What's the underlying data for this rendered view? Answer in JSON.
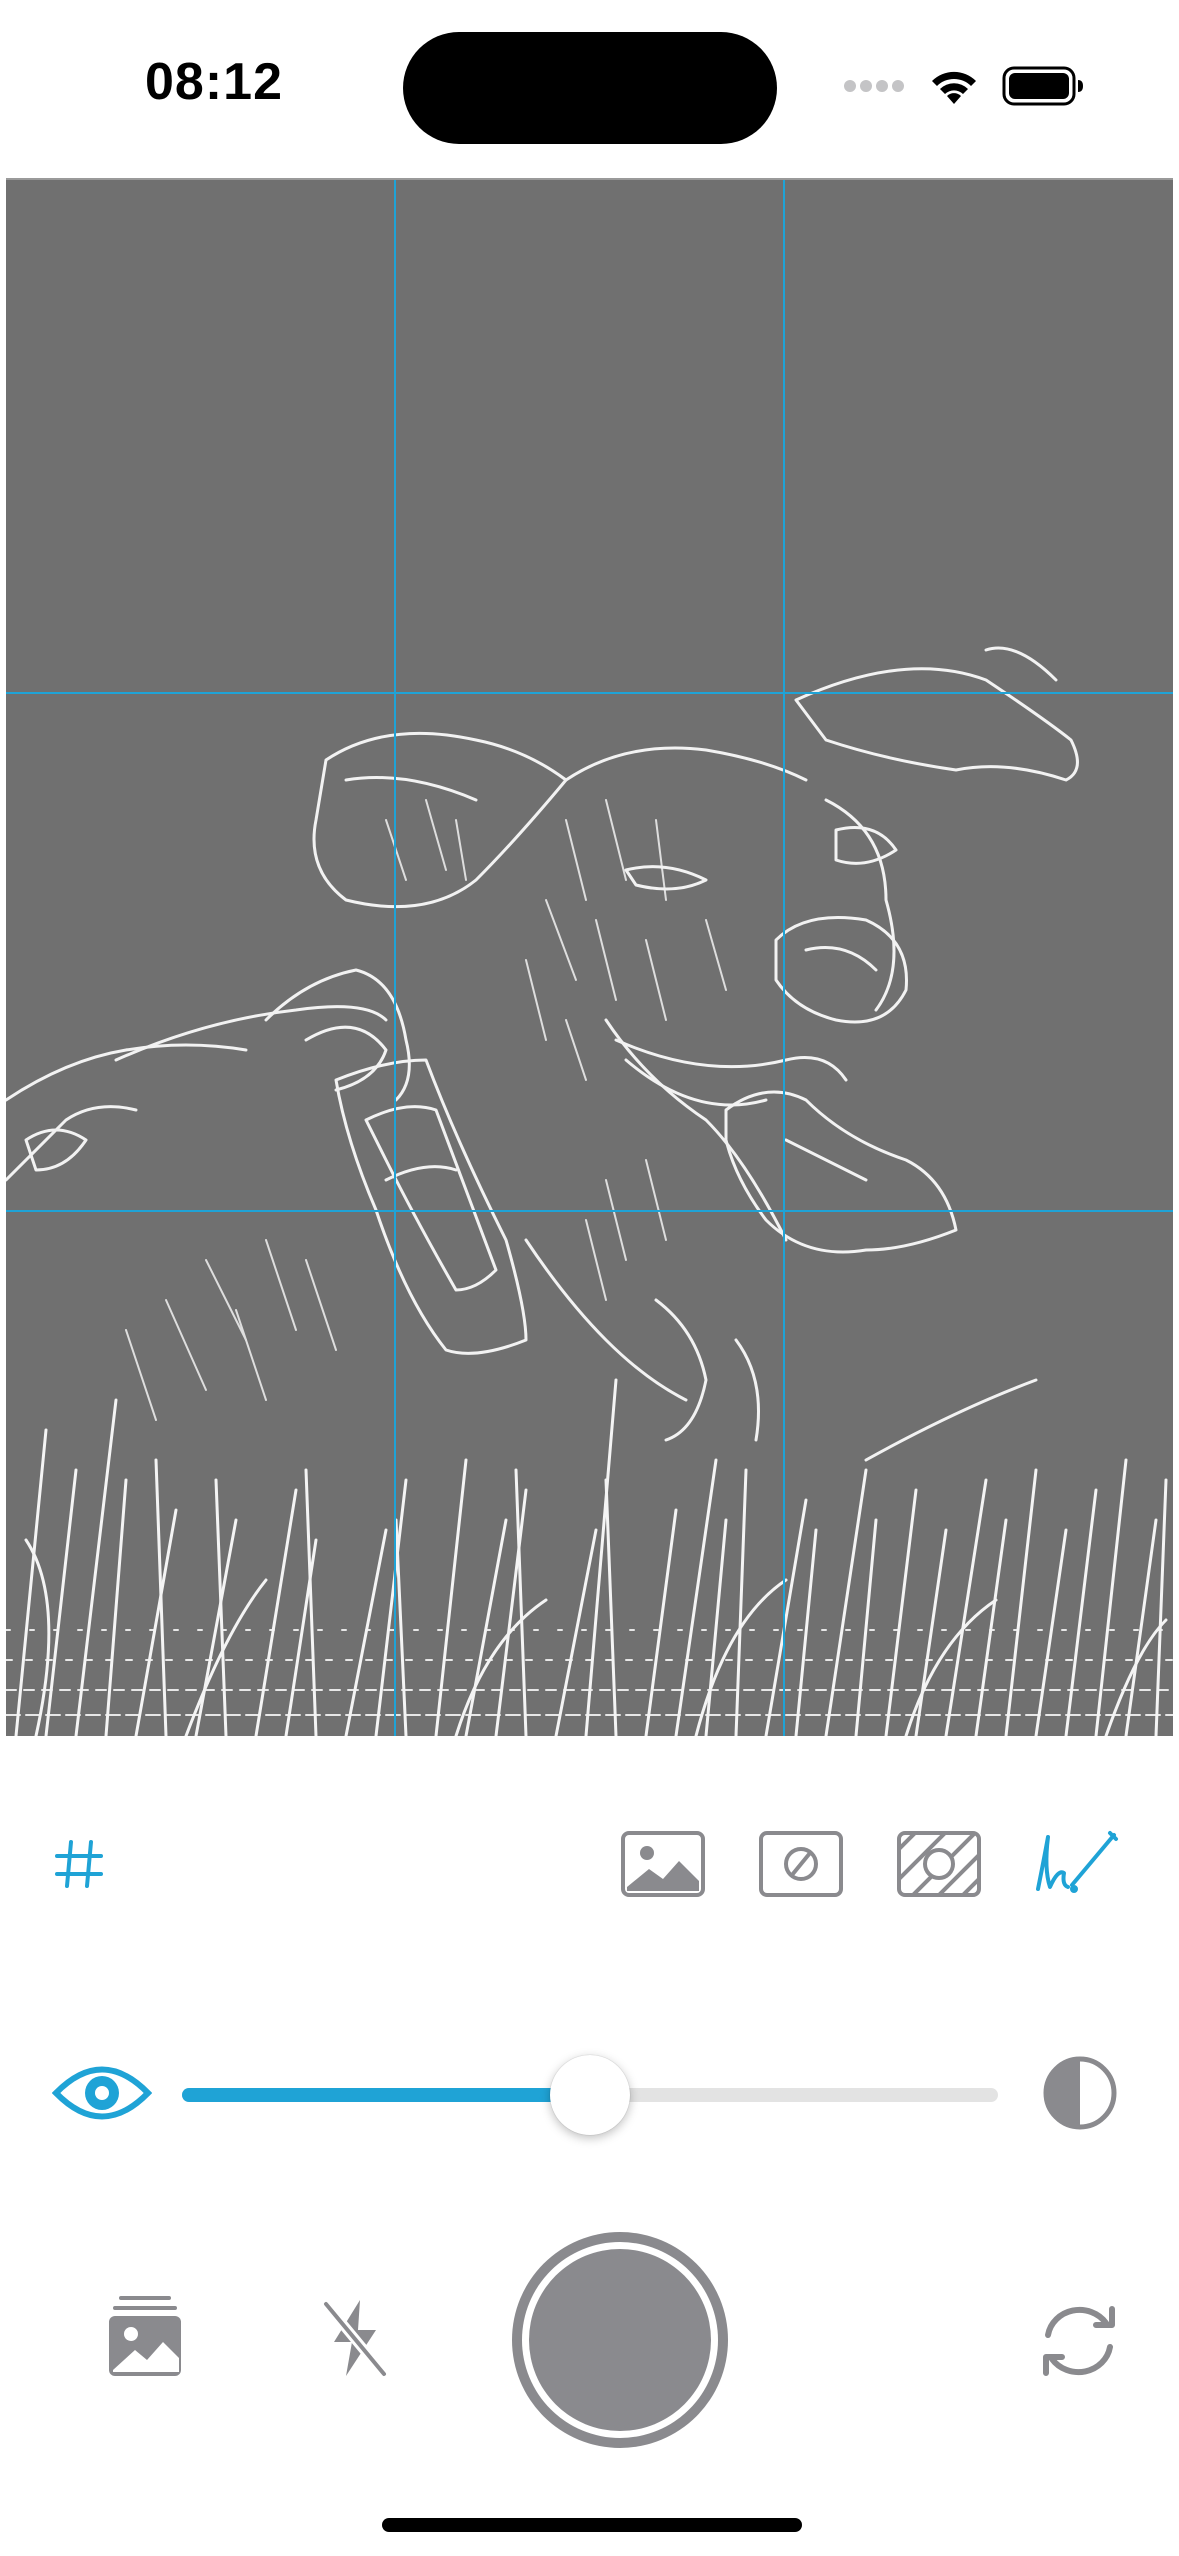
{
  "status_bar": {
    "time": "08:12"
  },
  "viewfinder": {
    "filter": "sketch-outline",
    "grid": "3x3",
    "grid_color": "#1fa3d6",
    "background_color": "#707070"
  },
  "toolbar": {
    "grid_toggle": {
      "icon": "grid-icon",
      "active": true
    },
    "modes": [
      {
        "icon": "photo-mode-icon",
        "active": false
      },
      {
        "icon": "threshold-mode-icon",
        "active": false
      },
      {
        "icon": "hatch-mode-icon",
        "active": false
      },
      {
        "icon": "sketch-mode-icon",
        "active": true
      }
    ]
  },
  "opacity_slider": {
    "left_icon": "eye-icon",
    "right_icon": "contrast-icon",
    "value": 0.5,
    "accent": "#1fa3d6"
  },
  "bottom_controls": {
    "gallery_icon": "photo-stack-icon",
    "flash_icon": "flash-off-icon",
    "shutter_icon": "shutter-button",
    "switch_camera_icon": "camera-switch-icon"
  },
  "colors": {
    "accent": "#1fa3d6",
    "inactive_icon": "#8a8a8e"
  }
}
